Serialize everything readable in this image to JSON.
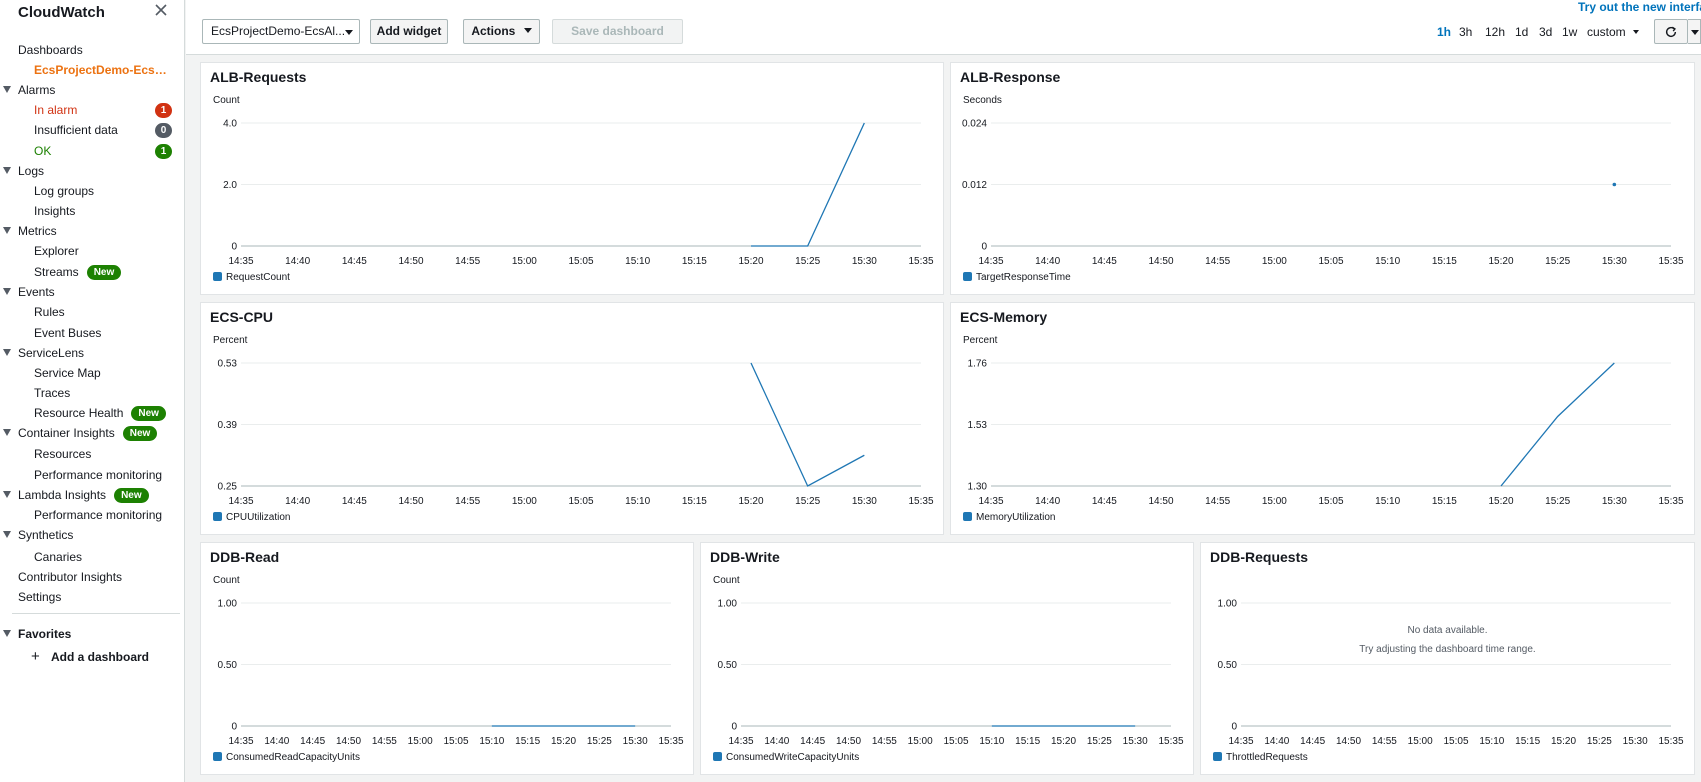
{
  "sidebar": {
    "title": "CloudWatch",
    "items": [
      {
        "label": "Dashboards",
        "level": 0,
        "expandable": false
      },
      {
        "label": "EcsProjectDemo-EcsAlbDashboard",
        "level": 1,
        "style": "active"
      },
      {
        "label": "Alarms",
        "level": 0,
        "expandable": true
      },
      {
        "label": "In alarm",
        "level": 1,
        "style": "alarm",
        "count": "1",
        "count_color": "#d13212"
      },
      {
        "label": "Insufficient data",
        "level": 1,
        "count": "0",
        "count_color": "#545b64"
      },
      {
        "label": "OK",
        "level": 1,
        "style": "ok",
        "count": "1",
        "count_color": "#1d8102"
      },
      {
        "label": "Logs",
        "level": 0,
        "expandable": true
      },
      {
        "label": "Log groups",
        "level": 1
      },
      {
        "label": "Insights",
        "level": 1
      },
      {
        "label": "Metrics",
        "level": 0,
        "expandable": true
      },
      {
        "label": "Explorer",
        "level": 1
      },
      {
        "label": "Streams",
        "level": 1,
        "new": "New"
      },
      {
        "label": "Events",
        "level": 0,
        "expandable": true
      },
      {
        "label": "Rules",
        "level": 1
      },
      {
        "label": "Event Buses",
        "level": 1
      },
      {
        "label": "ServiceLens",
        "level": 0,
        "expandable": true
      },
      {
        "label": "Service Map",
        "level": 1
      },
      {
        "label": "Traces",
        "level": 1
      },
      {
        "label": "Resource Health",
        "level": 1,
        "new": "New"
      },
      {
        "label": "Container Insights",
        "level": 0,
        "expandable": true,
        "new": "New"
      },
      {
        "label": "Resources",
        "level": 1
      },
      {
        "label": "Performance monitoring",
        "level": 1
      },
      {
        "label": "Lambda Insights",
        "level": 0,
        "expandable": true,
        "new": "New"
      },
      {
        "label": "Performance monitoring",
        "level": 1
      },
      {
        "label": "Synthetics",
        "level": 0,
        "expandable": true
      },
      {
        "label": "Canaries",
        "level": 1
      },
      {
        "label": "Contributor Insights",
        "level": 0,
        "expandable": false
      },
      {
        "label": "Settings",
        "level": 0,
        "expandable": false
      }
    ],
    "favorites_label": "Favorites",
    "add_dashboard_label": "Add a dashboard"
  },
  "toolbar": {
    "dashboard_select": "EcsProjectDemo-EcsAl...",
    "add_widget": "Add widget",
    "actions": "Actions",
    "save_dashboard": "Save dashboard",
    "try_new": "Try out the new interface",
    "ranges": [
      "1h",
      "3h",
      "12h",
      "1d",
      "3d",
      "1w"
    ],
    "selected_range": "1h",
    "custom": "custom"
  },
  "colors": {
    "series": "#1f77b4",
    "accent": "#ec7211",
    "link": "#0073bb"
  },
  "chart_data": [
    {
      "id": "alb-requests",
      "type": "line",
      "title": "ALB-Requests",
      "ylabel": "Count",
      "yticks": [
        "4.0",
        "2.0",
        "0"
      ],
      "ylim": [
        0,
        4
      ],
      "x": [
        "14:35",
        "14:40",
        "14:45",
        "14:50",
        "14:55",
        "15:00",
        "15:05",
        "15:10",
        "15:15",
        "15:20",
        "15:25",
        "15:30",
        "15:35"
      ],
      "series": [
        {
          "name": "RequestCount",
          "points": [
            [
              "15:20",
              0
            ],
            [
              "15:25",
              0
            ],
            [
              "15:30",
              4
            ]
          ]
        }
      ]
    },
    {
      "id": "alb-response",
      "type": "line",
      "title": "ALB-Response",
      "ylabel": "Seconds",
      "yticks": [
        "0.024",
        "0.012",
        "0"
      ],
      "ylim": [
        0,
        0.024
      ],
      "x": [
        "14:35",
        "14:40",
        "14:45",
        "14:50",
        "14:55",
        "15:00",
        "15:05",
        "15:10",
        "15:15",
        "15:20",
        "15:25",
        "15:30",
        "15:35"
      ],
      "series": [
        {
          "name": "TargetResponseTime",
          "points": [
            [
              "15:30",
              0.012
            ]
          ]
        }
      ]
    },
    {
      "id": "ecs-cpu",
      "type": "line",
      "title": "ECS-CPU",
      "ylabel": "Percent",
      "yticks": [
        "0.53",
        "0.39",
        "0.25"
      ],
      "ylim": [
        0.25,
        0.53
      ],
      "x": [
        "14:35",
        "14:40",
        "14:45",
        "14:50",
        "14:55",
        "15:00",
        "15:05",
        "15:10",
        "15:15",
        "15:20",
        "15:25",
        "15:30",
        "15:35"
      ],
      "series": [
        {
          "name": "CPUUtilization",
          "points": [
            [
              "15:20",
              0.53
            ],
            [
              "15:25",
              0.25
            ],
            [
              "15:30",
              0.32
            ]
          ]
        }
      ]
    },
    {
      "id": "ecs-memory",
      "type": "line",
      "title": "ECS-Memory",
      "ylabel": "Percent",
      "yticks": [
        "1.76",
        "1.53",
        "1.30"
      ],
      "ylim": [
        1.3,
        1.76
      ],
      "x": [
        "14:35",
        "14:40",
        "14:45",
        "14:50",
        "14:55",
        "15:00",
        "15:05",
        "15:10",
        "15:15",
        "15:20",
        "15:25",
        "15:30",
        "15:35"
      ],
      "series": [
        {
          "name": "MemoryUtilization",
          "points": [
            [
              "15:20",
              1.3
            ],
            [
              "15:25",
              1.56
            ],
            [
              "15:30",
              1.76
            ]
          ]
        }
      ]
    },
    {
      "id": "ddb-read",
      "type": "line",
      "title": "DDB-Read",
      "ylabel": "Count",
      "yticks": [
        "1.00",
        "0.50",
        "0"
      ],
      "ylim": [
        0,
        1
      ],
      "x": [
        "14:35",
        "14:40",
        "14:45",
        "14:50",
        "14:55",
        "15:00",
        "15:05",
        "15:10",
        "15:15",
        "15:20",
        "15:25",
        "15:30",
        "15:35"
      ],
      "series": [
        {
          "name": "ConsumedReadCapacityUnits",
          "points": [
            [
              "15:10",
              0
            ],
            [
              "15:15",
              0
            ],
            [
              "15:20",
              0
            ],
            [
              "15:25",
              0
            ],
            [
              "15:30",
              0
            ]
          ]
        }
      ]
    },
    {
      "id": "ddb-write",
      "type": "line",
      "title": "DDB-Write",
      "ylabel": "Count",
      "yticks": [
        "1.00",
        "0.50",
        "0"
      ],
      "ylim": [
        0,
        1
      ],
      "x": [
        "14:35",
        "14:40",
        "14:45",
        "14:50",
        "14:55",
        "15:00",
        "15:05",
        "15:10",
        "15:15",
        "15:20",
        "15:25",
        "15:30",
        "15:35"
      ],
      "series": [
        {
          "name": "ConsumedWriteCapacityUnits",
          "points": [
            [
              "15:10",
              0
            ],
            [
              "15:15",
              0
            ],
            [
              "15:20",
              0
            ],
            [
              "15:25",
              0
            ],
            [
              "15:30",
              0
            ]
          ]
        }
      ]
    },
    {
      "id": "ddb-requests",
      "type": "line",
      "title": "DDB-Requests",
      "ylabel": "",
      "yticks": [
        "1.00",
        "0.50",
        "0"
      ],
      "ylim": [
        0,
        1
      ],
      "x": [
        "14:35",
        "14:40",
        "14:45",
        "14:50",
        "14:55",
        "15:00",
        "15:05",
        "15:10",
        "15:15",
        "15:20",
        "15:25",
        "15:30",
        "15:35"
      ],
      "series": [
        {
          "name": "ThrottledRequests",
          "points": []
        }
      ],
      "no_data": "No data available.",
      "no_data_hint": "Try adjusting the dashboard time range."
    }
  ]
}
